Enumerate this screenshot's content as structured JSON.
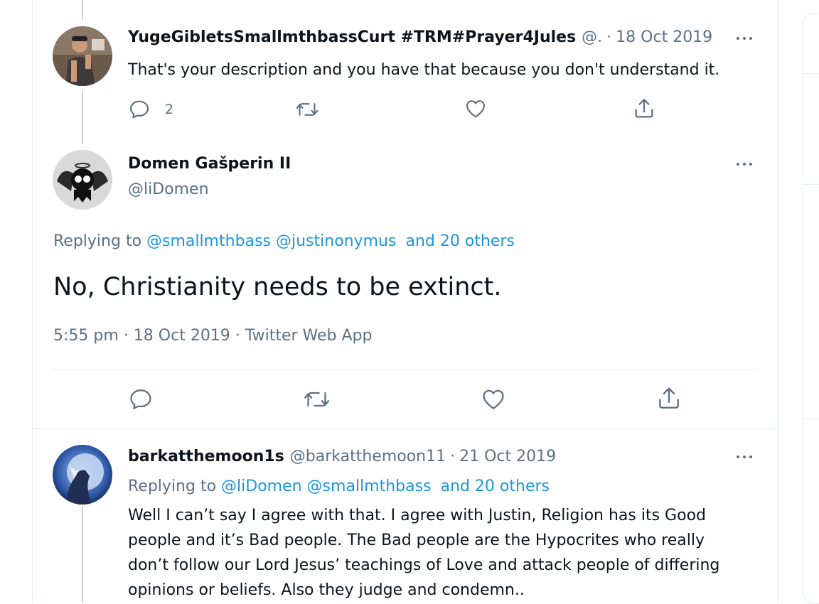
{
  "tweet1": {
    "name": "YugeGibletsSmallmthbassCurt #TRM#Prayer4Jules",
    "handle": "@.",
    "sep": "·",
    "date": "18 Oct 2019",
    "text": "That's your description and you have that because you don't understand it.",
    "reply_count": "2"
  },
  "main_tweet": {
    "name": "Domen Gašperin II",
    "handle": "@liDomen",
    "replying_prefix": "Replying to",
    "replying_to": [
      "@smallmthbass",
      "@justinonymus"
    ],
    "and_others": "and 20 others",
    "text": "No, Christianity needs to be extinct.",
    "time": "5:55 pm",
    "date": "18 Oct 2019",
    "source": "Twitter Web App",
    "sep": "·"
  },
  "tweet3": {
    "name": "barkatthemoon1s",
    "handle": "@barkatthemoon11",
    "sep": "·",
    "date": "21 Oct 2019",
    "replying_prefix": "Replying to",
    "replying_to": [
      "@liDomen",
      "@smallmthbass"
    ],
    "and_others": "and 20 others",
    "text_lines": [
      "Well I can’t say I agree with that. I agree with Justin, Religion has its Good",
      "people and it’s Bad people. The Bad people are the Hypocrites who really",
      "don’t follow our Lord Jesus’ teachings of Love and attack people of differing",
      "opinions or beliefs. Also they judge and condemn.."
    ]
  },
  "icons": {
    "reply": "reply-icon",
    "retweet": "retweet-icon",
    "like": "heart-icon",
    "share": "share-icon",
    "more": "more-icon"
  },
  "colors": {
    "text": "#0f1419",
    "muted": "#5b7083",
    "link": "#1b95e0",
    "border": "#e6ecf0",
    "thread_line": "#c4cfd6"
  }
}
